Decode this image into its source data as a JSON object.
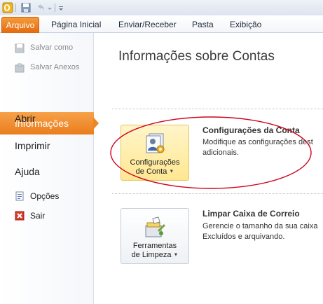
{
  "tabs": {
    "file": "Arquivo",
    "items": [
      "Página Inicial",
      "Enviar/Receber",
      "Pasta",
      "Exibição"
    ]
  },
  "nav": {
    "save_as": "Salvar como",
    "save_attachments": "Salvar Anexos",
    "info": "Informações",
    "open": "Abrir",
    "print": "Imprimir",
    "help": "Ajuda",
    "options": "Opções",
    "exit": "Sair"
  },
  "main": {
    "title": "Informações sobre Contas",
    "account": {
      "button_line1": "Configurações",
      "button_line2": "de Conta",
      "heading": "Configurações da Conta",
      "desc_line1": "Modifique as configurações dest",
      "desc_line2": "adicionais."
    },
    "cleanup": {
      "button_line1": "Ferramentas",
      "button_line2": "de Limpeza",
      "heading": "Limpar Caixa de Correio",
      "desc_line1": "Gerencie o tamanho da sua caixa",
      "desc_line2": "Excluídos e arquivando."
    }
  },
  "icons": {
    "app": "outlook-icon",
    "save": "save-icon",
    "undo": "undo-icon",
    "customize": "customize-qat-icon",
    "account_settings": "account-settings-icon",
    "cleanup_tools": "cleanup-tools-icon",
    "options": "options-icon",
    "exit": "exit-icon"
  },
  "colors": {
    "file_tab": "#e46a0c",
    "selected_nav": "#ea7d1c",
    "annotation": "#d0021b"
  }
}
